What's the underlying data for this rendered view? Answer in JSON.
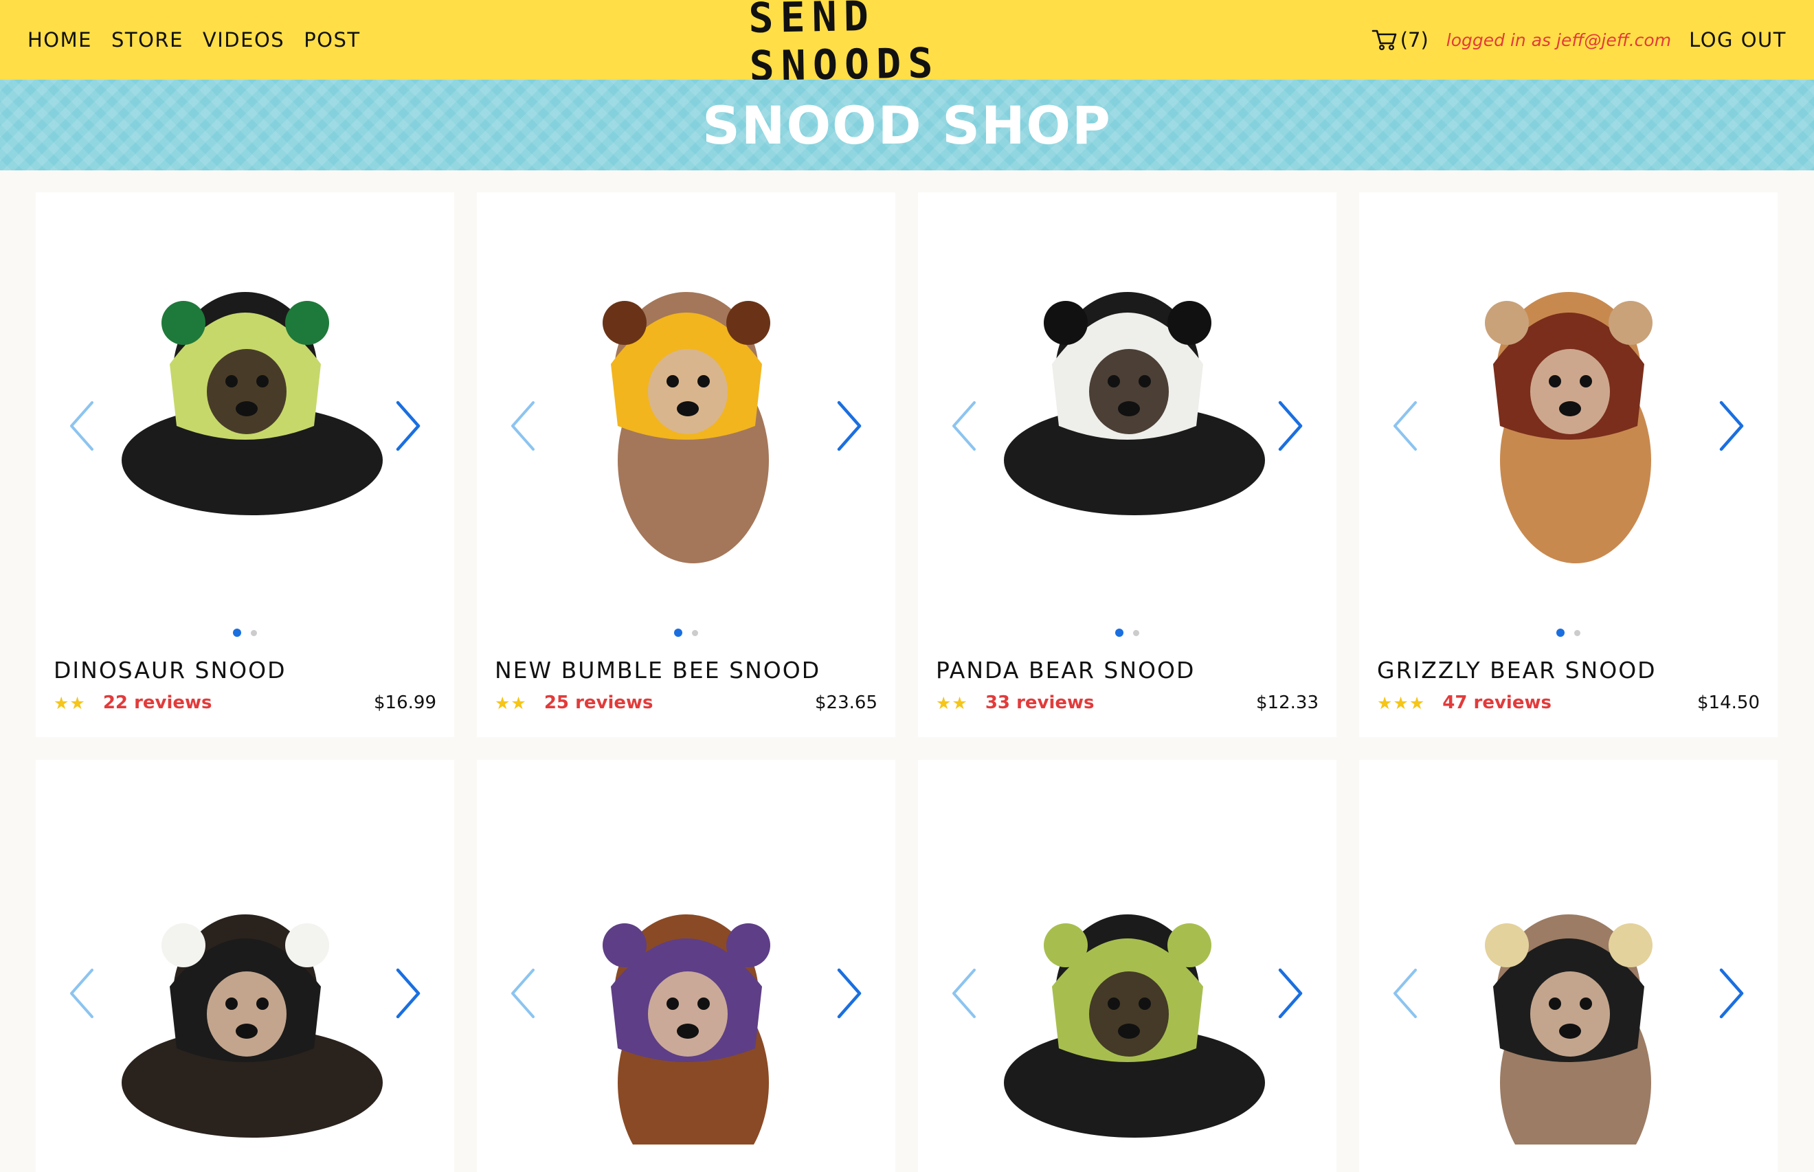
{
  "nav": {
    "links": [
      "HOME",
      "STORE",
      "VIDEOS",
      "POST"
    ],
    "logo": "SEND SNOODS",
    "cart_count": "(7)",
    "logged_in_text": "logged in as jeff@jeff.com",
    "logout_label": "LOG OUT"
  },
  "banner": {
    "title": "SNOOD SHOP"
  },
  "colors": {
    "header_bg": "#ffde47",
    "banner_bg": "#84d1dd",
    "accent_blue": "#1a6fe0",
    "review_red": "#e23b3b",
    "star_gold": "#f5c518"
  },
  "products": [
    {
      "name": "DINOSAUR SNOOD",
      "stars": 2,
      "reviews": "22 reviews",
      "price": "$16.99",
      "snood_color": "#c7d86a",
      "accent_color": "#1e7a3a",
      "dog_color": "#1b1b1b",
      "icon": "dog-photo-dinosaur"
    },
    {
      "name": "NEW BUMBLE BEE SNOOD",
      "stars": 2,
      "reviews": "25 reviews",
      "price": "$23.65",
      "snood_color": "#f2b51d",
      "accent_color": "#6a3317",
      "dog_color": "#a4775a",
      "icon": "dog-photo-bumblebee"
    },
    {
      "name": "PANDA BEAR SNOOD",
      "stars": 2,
      "reviews": "33 reviews",
      "price": "$12.33",
      "snood_color": "#eeeeea",
      "accent_color": "#111111",
      "dog_color": "#1b1b1b",
      "icon": "dog-photo-panda"
    },
    {
      "name": "GRIZZLY BEAR SNOOD",
      "stars": 3,
      "reviews": "47 reviews",
      "price": "$14.50",
      "snood_color": "#7a2e1b",
      "accent_color": "#c9a27a",
      "dog_color": "#c8894f",
      "icon": "dog-photo-grizzly"
    },
    {
      "name": "",
      "snood_color": "#1b1b1b",
      "accent_color": "#f3f3f0",
      "dog_color": "#2a221d",
      "icon": "dog-photo-cow"
    },
    {
      "name": "",
      "snood_color": "#5e3e86",
      "accent_color": "#5e3e86",
      "dog_color": "#8a4a25",
      "icon": "dog-photo-purple-snood"
    },
    {
      "name": "",
      "snood_color": "#a7be4f",
      "accent_color": "#a7be4f",
      "dog_color": "#1b1b1b",
      "icon": "dog-photo-yoda"
    },
    {
      "name": "",
      "snood_color": "#1d1d1d",
      "accent_color": "#e4d29c",
      "dog_color": "#9c7c64",
      "icon": "dog-photo-black-bear"
    }
  ]
}
